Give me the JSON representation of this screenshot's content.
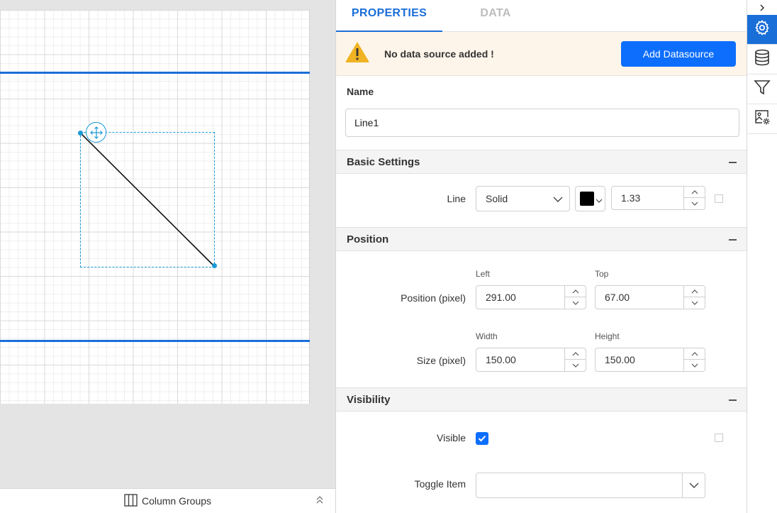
{
  "canvas": {
    "footer_label": "Column Groups"
  },
  "tabs": [
    {
      "label": "PROPERTIES",
      "active": true
    },
    {
      "label": "DATA",
      "active": false
    }
  ],
  "warning": {
    "message": "No data source added !",
    "button_label": "Add Datasource"
  },
  "name": {
    "label": "Name",
    "value": "Line1"
  },
  "basic_settings": {
    "title": "Basic Settings",
    "line_label": "Line",
    "line_style": "Solid",
    "line_color": "#000000",
    "line_width": "1.33"
  },
  "position": {
    "title": "Position",
    "position_label": "Position (pixel)",
    "left_label": "Left",
    "left_value": "291.00",
    "top_label": "Top",
    "top_value": "67.00",
    "size_label": "Size (pixel)",
    "width_label": "Width",
    "width_value": "150.00",
    "height_label": "Height",
    "height_value": "150.00"
  },
  "visibility": {
    "title": "Visibility",
    "visible_label": "Visible",
    "visible_checked": true,
    "toggle_label": "Toggle Item",
    "toggle_value": ""
  },
  "rail": {
    "items": [
      {
        "icon": "gear-icon",
        "active": true
      },
      {
        "icon": "database-icon",
        "active": false
      },
      {
        "icon": "filter-icon",
        "active": false
      },
      {
        "icon": "image-settings-icon",
        "active": false
      }
    ]
  },
  "colors": {
    "accent": "#1a6ed8",
    "button": "#0d6efd",
    "warning_bg": "#fdf5e9",
    "warning_icon": "#f0b323"
  }
}
